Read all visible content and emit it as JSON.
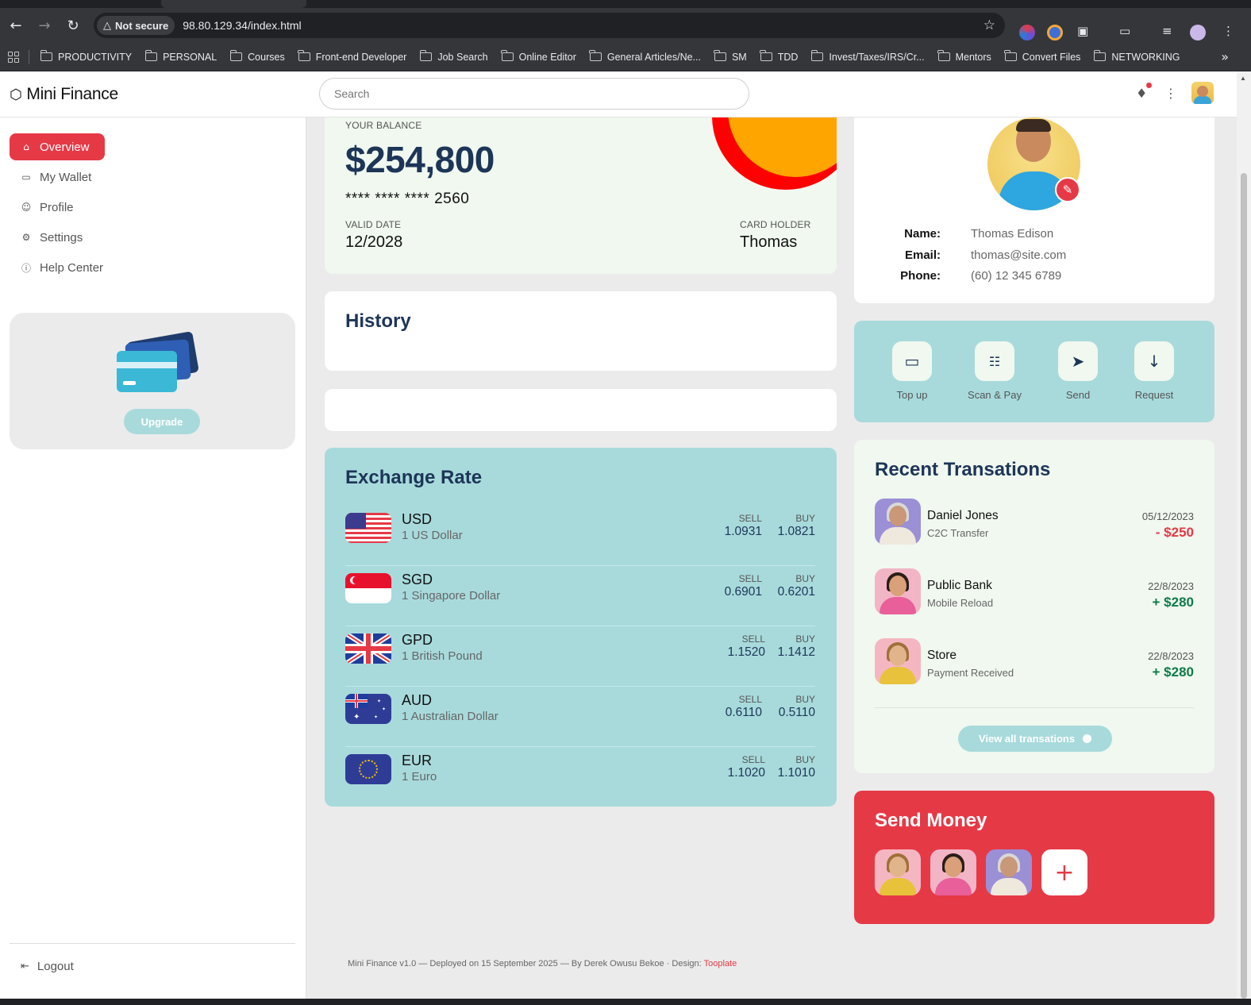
{
  "browser": {
    "security_label": "Not secure",
    "url": "98.80.129.34/index.html",
    "bookmarks": [
      "PRODUCTIVITY",
      "PERSONAL",
      "Courses",
      "Front-end Developer",
      "Job Search",
      "Online Editor",
      "General Articles/Ne...",
      "SM",
      "TDD",
      "Invest/Taxes/IRS/Cr...",
      "Mentors",
      "Convert Files",
      "NETWORKING"
    ]
  },
  "header": {
    "brand": "Mini Finance",
    "search_placeholder": "Search"
  },
  "sidebar": {
    "items": [
      {
        "label": "Overview",
        "icon": "home-icon",
        "active": true
      },
      {
        "label": "My Wallet",
        "icon": "wallet-icon",
        "active": false
      },
      {
        "label": "Profile",
        "icon": "person-icon",
        "active": false
      },
      {
        "label": "Settings",
        "icon": "gear-icon",
        "active": false
      },
      {
        "label": "Help Center",
        "icon": "help-icon",
        "active": false
      }
    ],
    "upgrade_label": "Upgrade",
    "logout_label": "Logout"
  },
  "balance": {
    "label": "YOUR BALANCE",
    "amount": "$254,800",
    "card_number": "**** **** **** 2560",
    "valid_label": "VALID DATE",
    "valid_value": "12/2028",
    "holder_label": "CARD HOLDER",
    "holder_value": "Thomas"
  },
  "history": {
    "title": "History"
  },
  "exchange": {
    "title": "Exchange Rate",
    "sell_label": "SELL",
    "buy_label": "BUY",
    "rates": [
      {
        "code": "USD",
        "name": "1 US Dollar",
        "sell": "1.0931",
        "buy": "1.0821",
        "flag": "us-flag"
      },
      {
        "code": "SGD",
        "name": "1 Singapore Dollar",
        "sell": "0.6901",
        "buy": "0.6201",
        "flag": "sg-flag"
      },
      {
        "code": "GPD",
        "name": "1 British Pound",
        "sell": "1.1520",
        "buy": "1.1412",
        "flag": "uk-flag"
      },
      {
        "code": "AUD",
        "name": "1 Australian Dollar",
        "sell": "0.6110",
        "buy": "0.5110",
        "flag": "au-flag"
      },
      {
        "code": "EUR",
        "name": "1 Euro",
        "sell": "1.1020",
        "buy": "1.1010",
        "flag": "eu-flag"
      }
    ]
  },
  "profile": {
    "name_label": "Name:",
    "name": "Thomas Edison",
    "email_label": "Email:",
    "email": "thomas@site.com",
    "phone_label": "Phone:",
    "phone": "(60) 12 345 6789"
  },
  "actions": [
    {
      "label": "Top up",
      "icon": "card-icon"
    },
    {
      "label": "Scan & Pay",
      "icon": "barcode-icon"
    },
    {
      "label": "Send",
      "icon": "send-icon"
    },
    {
      "label": "Request",
      "icon": "arrow-down-icon"
    }
  ],
  "recent": {
    "title": "Recent Transations",
    "items": [
      {
        "name": "Daniel Jones",
        "type": "C2C Transfer",
        "date": "05/12/2023",
        "amount": "- $250",
        "direction": "out"
      },
      {
        "name": "Public Bank",
        "type": "Mobile Reload",
        "date": "22/8/2023",
        "amount": "+ $280",
        "direction": "in"
      },
      {
        "name": "Store",
        "type": "Payment Received",
        "date": "22/8/2023",
        "amount": "+ $280",
        "direction": "in"
      }
    ],
    "view_all_label": "View all transations"
  },
  "send_money": {
    "title": "Send Money"
  },
  "footer": {
    "text": "Mini Finance v1.0 — Deployed on 15 September 2025 — By Derek Owusu Bekoe · Design: ",
    "link": "Tooplate"
  },
  "colors": {
    "accent": "#e63946",
    "navy": "#1d3557",
    "teal": "#a8dadc",
    "mint": "#f0f8ef"
  }
}
